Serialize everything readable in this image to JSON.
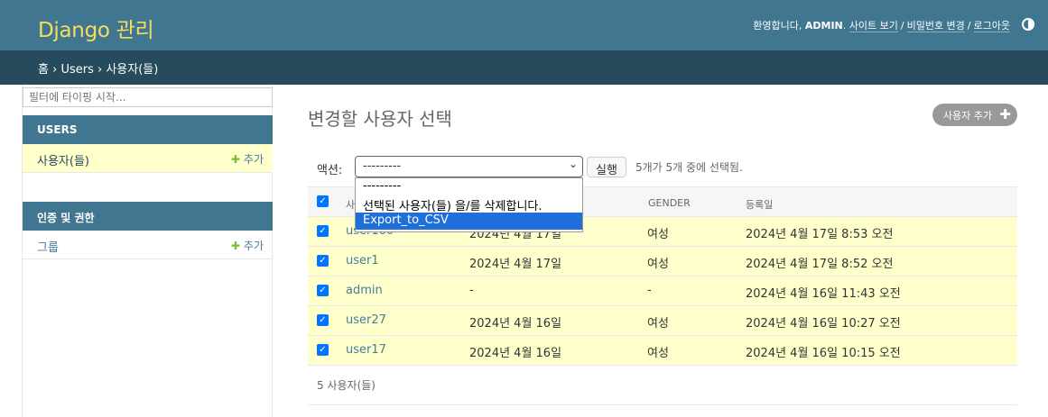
{
  "header": {
    "brand": "Django 관리",
    "welcome": "환영합니다, ",
    "username": "ADMIN",
    "view_site": "사이트 보기",
    "change_password": "비밀번호 변경",
    "logout": "로그아웃",
    "theme_icon": "half-circle-icon"
  },
  "breadcrumbs": {
    "home": "홈",
    "app": "Users",
    "current": "사용자(들)",
    "sep": " › "
  },
  "sidebar": {
    "filter_placeholder": "필터에 타이핑 시작...",
    "modules": [
      {
        "caption": "USERS",
        "items": [
          {
            "name": "사용자(들)",
            "add": "추가"
          }
        ]
      },
      {
        "caption": "인증 및 권한",
        "items": [
          {
            "name": "그룹",
            "add": "추가"
          }
        ]
      }
    ]
  },
  "main": {
    "title": "변경할 사용자 선택",
    "add_button": "사용자 추가",
    "actions_label": "액션:",
    "action_selected": "---------",
    "run_button": "실행",
    "selection_count": "5개가 5개 중에 선택됨.",
    "dropdown_options": [
      "---------",
      "선택된 사용자(들) 을/를 삭제합니다.",
      "Export_to_CSV"
    ],
    "columns": [
      "사용자 이름",
      "",
      "GENDER",
      "등록일"
    ],
    "rows": [
      {
        "username": "user100",
        "date": "2024년 4월 17일",
        "gender": "여성",
        "registered": "2024년 4월 17일 8:53 오전"
      },
      {
        "username": "user1",
        "date": "2024년 4월 17일",
        "gender": "여성",
        "registered": "2024년 4월 17일 8:52 오전"
      },
      {
        "username": "admin",
        "date": "-",
        "gender": "-",
        "registered": "2024년 4월 16일 11:43 오전"
      },
      {
        "username": "user27",
        "date": "2024년 4월 16일",
        "gender": "여성",
        "registered": "2024년 4월 16일 10:27 오전"
      },
      {
        "username": "user17",
        "date": "2024년 4월 16일",
        "gender": "여성",
        "registered": "2024년 4월 16일 10:15 오전"
      }
    ],
    "result_count": "5 사용자(들)"
  },
  "colors": {
    "header_bg": "#417690",
    "breadcrumb_bg": "#264b5d",
    "brand": "#f5dd5d",
    "selected_row": "#ffffcc",
    "link": "#447e9b",
    "dropdown_highlight": "#1e6fd9"
  }
}
